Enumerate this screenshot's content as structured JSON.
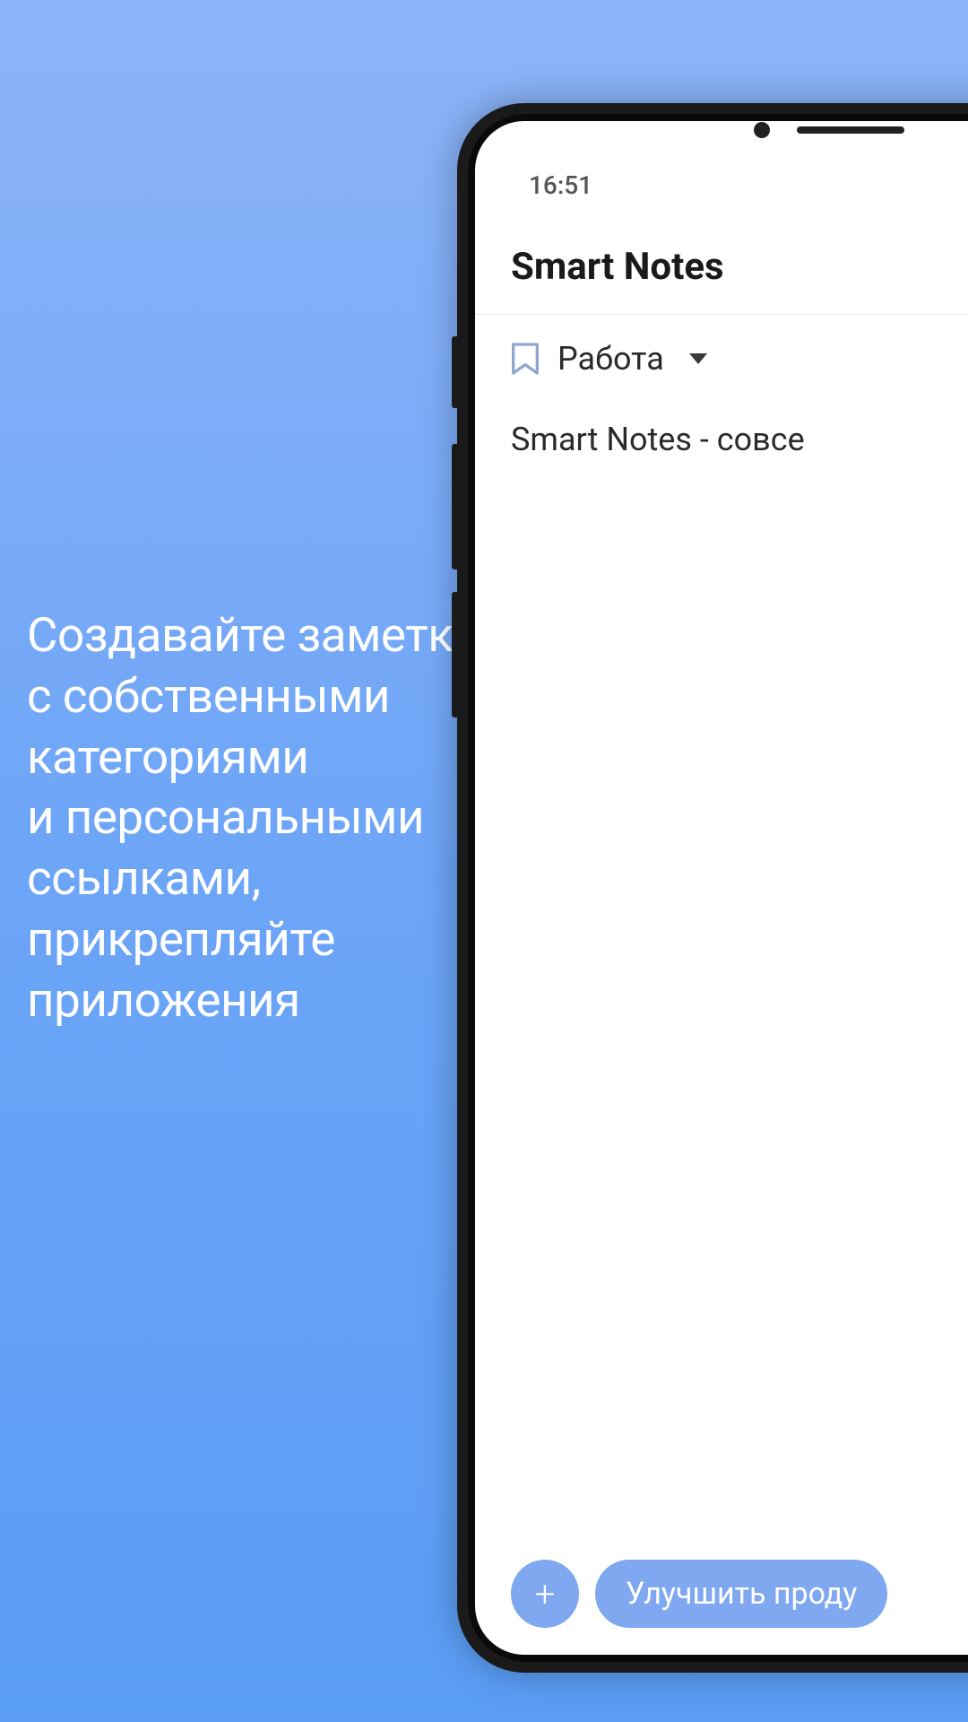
{
  "promo": {
    "line1": "Создавайте заметки",
    "line2": "с собственными",
    "line3": "категориями",
    "line4": "и персональными",
    "line5": "ссылками,",
    "line6": "прикрепляйте",
    "line7": "приложения"
  },
  "statusBar": {
    "time": "16:51"
  },
  "header": {
    "title": "Smart Notes"
  },
  "category": {
    "label": "Работа"
  },
  "note": {
    "text": "Smart Notes - совсе"
  },
  "fab": {
    "label": "+"
  },
  "chip": {
    "label": "Улучшить проду"
  }
}
